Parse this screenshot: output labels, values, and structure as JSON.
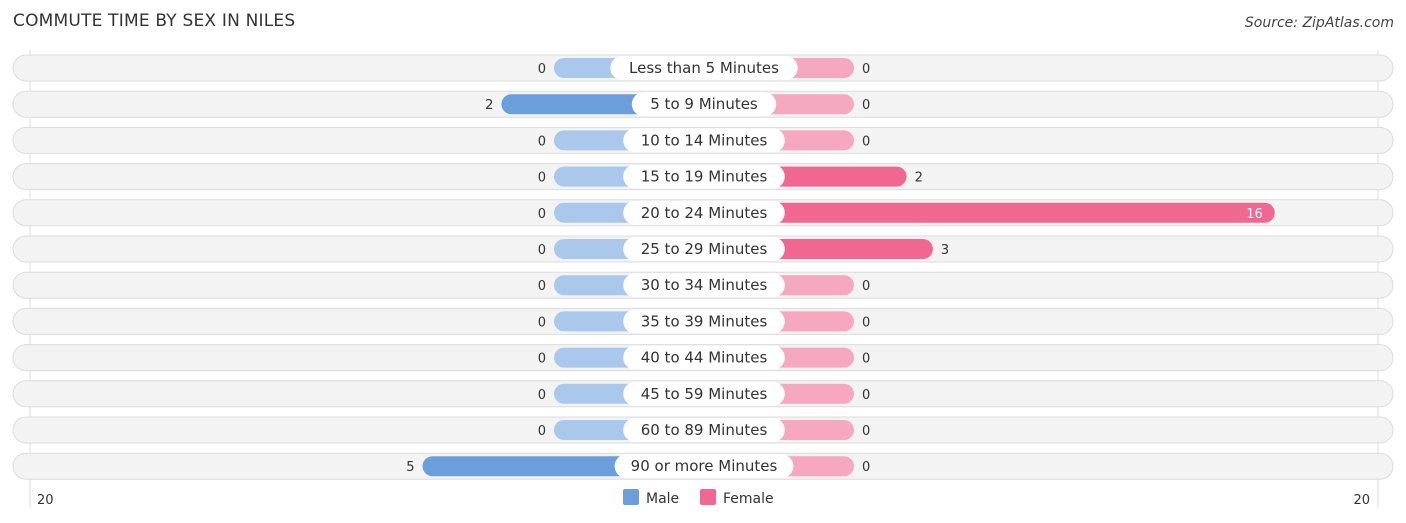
{
  "chart_data": {
    "type": "bar",
    "title": "COMMUTE TIME BY SEX IN NILES",
    "source": "Source: ZipAtlas.com",
    "categories": [
      "Less than 5 Minutes",
      "5 to 9 Minutes",
      "10 to 14 Minutes",
      "15 to 19 Minutes",
      "20 to 24 Minutes",
      "25 to 29 Minutes",
      "30 to 34 Minutes",
      "35 to 39 Minutes",
      "40 to 44 Minutes",
      "45 to 59 Minutes",
      "60 to 89 Minutes",
      "90 or more Minutes"
    ],
    "series": [
      {
        "name": "Male",
        "color": "#6a9fdb",
        "light_color": "#a9c8ec",
        "values": [
          0,
          2,
          0,
          0,
          0,
          0,
          0,
          0,
          0,
          0,
          0,
          5
        ]
      },
      {
        "name": "Female",
        "color": "#f06792",
        "light_color": "#f5a8c0",
        "values": [
          0,
          0,
          0,
          2,
          16,
          3,
          0,
          0,
          0,
          0,
          0,
          0
        ]
      }
    ],
    "axis_min_label": "20",
    "axis_max_label": "20",
    "xlim": [
      -20,
      20
    ],
    "legend_position": "bottom-center"
  }
}
